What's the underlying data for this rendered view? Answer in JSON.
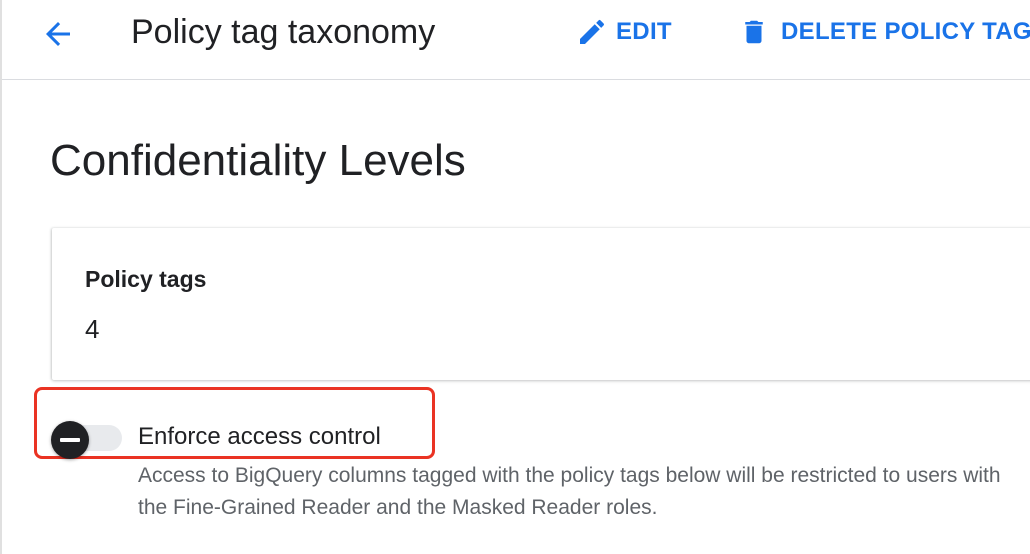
{
  "header": {
    "title": "Policy tag taxonomy",
    "back_icon": "arrow-back-icon",
    "actions": {
      "edit_label": "EDIT",
      "edit_icon": "pencil-icon",
      "delete_label": "DELETE POLICY TAG T",
      "delete_icon": "trash-icon"
    }
  },
  "taxonomy": {
    "name": "Confidentiality Levels"
  },
  "summary_card": {
    "label": "Policy tags",
    "value": "4"
  },
  "access_control": {
    "label": "Enforce access control",
    "state": "off",
    "description": "Access to BigQuery columns tagged with the policy tags below will be restricted to users with the Fine-Grained Reader and the Masked Reader roles."
  },
  "colors": {
    "accent": "#1a73e8",
    "highlight": "#ea3323",
    "text_primary": "#202124",
    "text_secondary": "#5f6368"
  }
}
